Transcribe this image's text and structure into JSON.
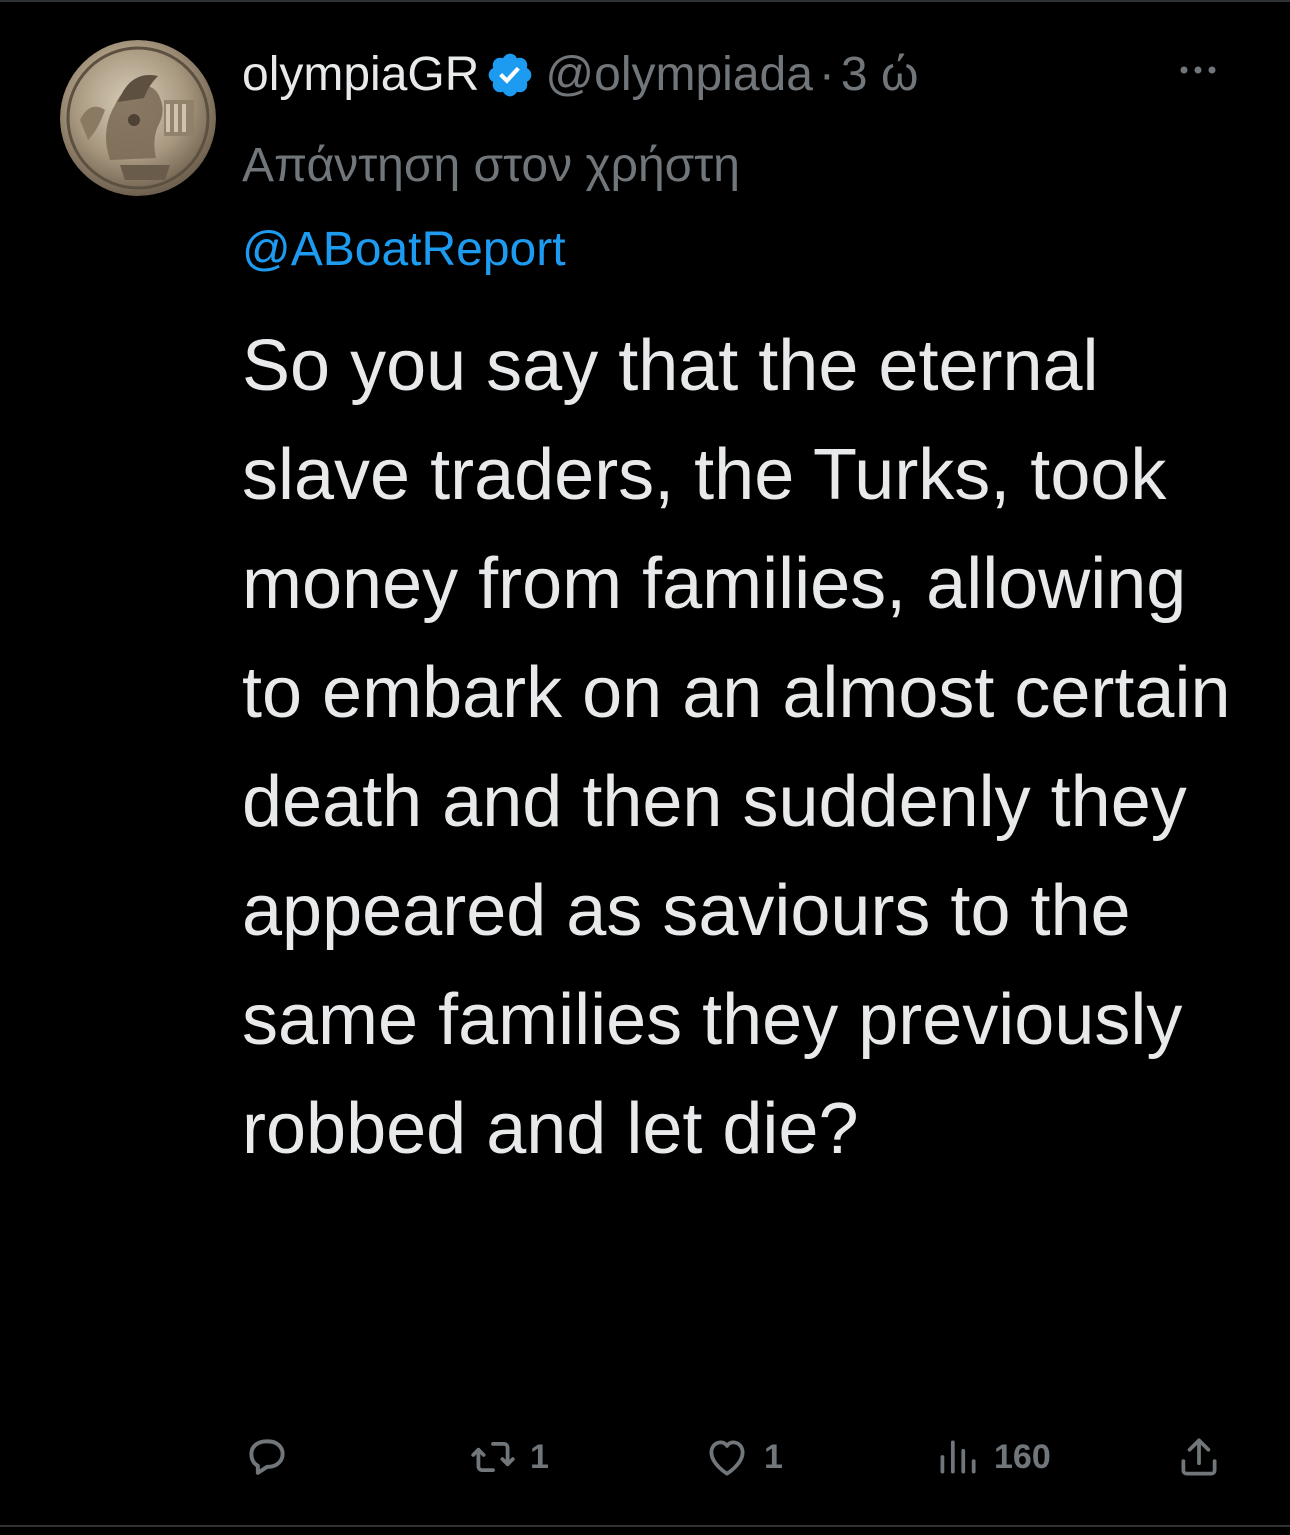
{
  "tweet": {
    "display_name": "olympiaGR",
    "handle": "@olympiada",
    "separator": "·",
    "time": "3 ώ",
    "reply_prefix": "Απάντηση στον χρήστη",
    "reply_to": "@ABoatReport",
    "text": "So you say that the eternal slave traders, the Turks, took money from families, allowing to embark on an almost certain death and then suddenly they appeared as saviours to the same families they previously robbed and let die?",
    "icons": {
      "verified": "verified-badge-icon",
      "more": "more-dots-icon"
    }
  },
  "actions": {
    "reply": {
      "icon": "reply-bubble-icon",
      "count": ""
    },
    "retweet": {
      "icon": "retweet-icon",
      "count": "1"
    },
    "like": {
      "icon": "heart-icon",
      "count": "1"
    },
    "views": {
      "icon": "views-bars-icon",
      "count": "160"
    },
    "share": {
      "icon": "share-upload-icon"
    }
  },
  "colors": {
    "background": "#000000",
    "text": "#e7e9ea",
    "muted": "#71767b",
    "link": "#1d9bf0",
    "verified": "#1d9bf0"
  }
}
